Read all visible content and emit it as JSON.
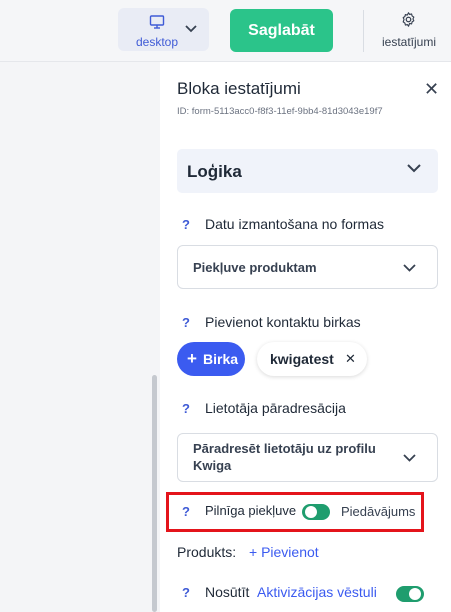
{
  "topbar": {
    "device_label": "desktop",
    "save_label": "Saglabāt",
    "settings_label": "iestatījumi"
  },
  "panel": {
    "title": "Bloka iestatījumi",
    "id_text": "ID: form-5113acc0-f8f3-11ef-9bb4-81d3043e19f7",
    "section_title": "Loģika",
    "help_mark": "?",
    "data_usage": {
      "label": "Datu izmantošana no formas",
      "value": "Piekļuve produktam"
    },
    "contact_tags": {
      "label": "Pievienot kontaktu birkas",
      "add_label": "Birka",
      "tags": [
        "kwigatest"
      ]
    },
    "redirect": {
      "label": "Lietotāja pāradresācija",
      "value_line1": "Pāradresēt lietotāju uz profilu",
      "value_line2": "Kwiga"
    },
    "full_access": {
      "label": "Pilnīga piekļuve",
      "toggle_on": true,
      "offer_label": "Piedāvājums"
    },
    "products": {
      "label": "Produkts:",
      "add_label": "+ Pievienot"
    },
    "send": {
      "label": "Nosūtīt",
      "link": "Aktivizācijas vēstuli",
      "toggle_on": true
    }
  },
  "colors": {
    "accent": "#3b5bf0",
    "save": "#2bc48a",
    "toggle_on": "#1f9d6e",
    "highlight": "#e4141b"
  }
}
